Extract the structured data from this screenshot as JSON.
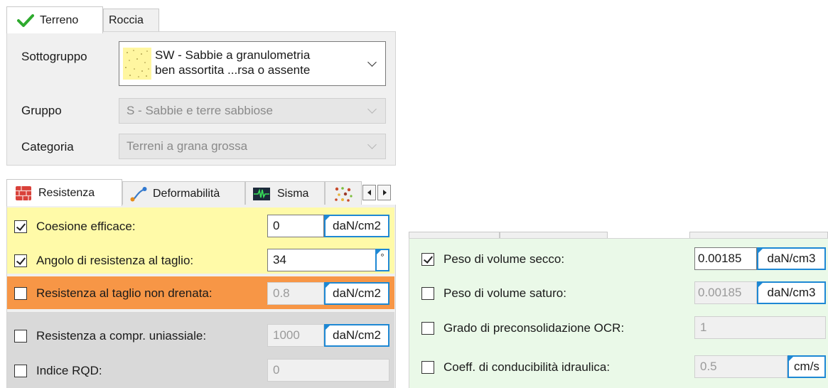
{
  "top_tabs": [
    {
      "label": "Terreno",
      "icon": "checkmark-icon",
      "active": true
    },
    {
      "label": "Roccia",
      "active": false
    }
  ],
  "classification": {
    "sottogruppo_label": "Sottogruppo",
    "sottogruppo_line1": "SW - Sabbie a granulometria",
    "sottogruppo_line2": "ben assortita ...rsa o assente",
    "gruppo_label": "Gruppo",
    "gruppo_value": "S - Sabbie e terre sabbiose",
    "categoria_label": "Categoria",
    "categoria_value": "Terreni a grana grossa"
  },
  "param_tabs": [
    {
      "label": "Resistenza",
      "icon": "brick-wall-icon"
    },
    {
      "label": "Deformabilità",
      "icon": "deformation-curve-icon"
    },
    {
      "label": "Sisma",
      "icon": "seismograph-icon"
    },
    {
      "label": "",
      "icon": "particles-icon"
    }
  ],
  "resistenza": [
    {
      "label": "Coesione efficace:",
      "checked": true,
      "value": "0",
      "unit": "daN/cm2",
      "enabled": true
    },
    {
      "label": "Angolo di resistenza al taglio:",
      "checked": true,
      "value": "34",
      "unit": "°",
      "enabled": true
    },
    {
      "label": "Resistenza al taglio non drenata:",
      "checked": false,
      "value": "0.8",
      "unit": "daN/cm2",
      "enabled": false
    },
    {
      "label": "Resistenza a compr. uniassiale:",
      "checked": false,
      "value": "1000",
      "unit": "daN/cm2",
      "enabled": false
    },
    {
      "label": "Indice RQD:",
      "checked": false,
      "value": "0",
      "unit": "",
      "enabled": false
    }
  ],
  "fisiche": [
    {
      "label": "Peso di volume secco:",
      "checked": true,
      "value": "0.00185",
      "unit": "daN/cm3",
      "enabled": true
    },
    {
      "label": "Peso di volume saturo:",
      "checked": false,
      "value": "0.00185",
      "unit": "daN/cm3",
      "enabled": false
    },
    {
      "label": "Grado di preconsolidazione OCR:",
      "checked": false,
      "value": "1",
      "unit": "",
      "enabled": false
    },
    {
      "label": "Coeff. di conducibilità idraulica:",
      "checked": false,
      "value": "0.5",
      "unit": "cm/s",
      "enabled": false
    }
  ],
  "colors": {
    "yellow_row": "#fffaa8",
    "orange_row": "#f79646",
    "gray_row": "#d9d9d9",
    "green_panel": "#eaf9e8",
    "unit_border": "#1e88d4",
    "check_green": "#2eaa2e"
  }
}
